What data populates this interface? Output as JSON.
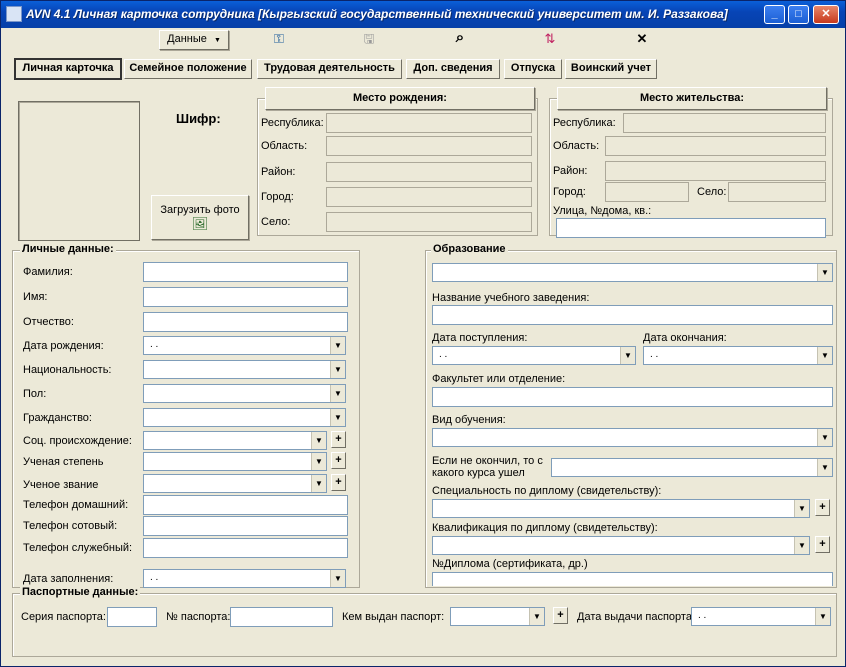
{
  "window": {
    "title": "AVN 4.1 Личная карточка сотрудника [Кыргызский государственный технический университет им. И. Раззакова]",
    "min": "_",
    "max": "□",
    "close": "✕"
  },
  "toolbar": {
    "data_menu": "Данные",
    "data_menu_arrow": "▼",
    "icons": {
      "key": "⚿",
      "save": "🖫",
      "search": "⌕",
      "sort": "⇅",
      "close": "✕"
    }
  },
  "tabs": [
    "Личная карточка",
    "Семейное положение",
    "Трудовая деятельность",
    "Доп. сведения",
    "Отпуска",
    "Воинский учет"
  ],
  "photo": {
    "cipher_label": "Шифр:",
    "upload_button": "Загрузить фото",
    "upload_icon": "🖼"
  },
  "birthplace": {
    "header": "Место рождения:",
    "labels": [
      "Республика:",
      "Область:",
      "Район:",
      "Город:",
      "Село:"
    ]
  },
  "residence": {
    "header": "Место жительства:",
    "labels": {
      "republic": "Республика:",
      "region": "Область:",
      "district": "Район:",
      "city": "Город:",
      "village": "Село:",
      "street": "Улица, №дома, кв.:"
    }
  },
  "personal": {
    "title": "Личные данные:",
    "labels": [
      "Фамилия:",
      "Имя:",
      "Отчество:",
      "Дата рождения:",
      "Национальность:",
      "Пол:",
      "Гражданство:",
      "Соц. происхождение:",
      "Ученая степень",
      "Ученое звание",
      "Телефон домашний:",
      "Телефон сотовый:",
      "Телефон служебный:",
      "Дата заполнения:"
    ],
    "date_placeholder": ". ."
  },
  "education": {
    "title": "Образование",
    "labels": {
      "institution": "Название учебного заведения:",
      "admission_date": "Дата поступления:",
      "graduation_date": "Дата окончания:",
      "faculty": "Факультет или отделение:",
      "study_form": "Вид обучения:",
      "dropout_course": "Если не окончил, то с какого курса ушел",
      "specialty": "Специальность по диплому (свидетельству):",
      "qualification": "Квалификация по диплому (свидетельству):",
      "diploma_no": "№Диплома (сертификата, др.)"
    },
    "date_placeholder": ". ."
  },
  "passport": {
    "title": "Паспортные данные:",
    "labels": {
      "series": "Серия паспорта:",
      "number": "№ паспорта:",
      "issued_by": "Кем выдан паспорт:",
      "issue_date": "Дата выдачи паспорта"
    },
    "date_placeholder": ". ."
  },
  "plus_label": "+",
  "dropdown_arrow": "▼"
}
